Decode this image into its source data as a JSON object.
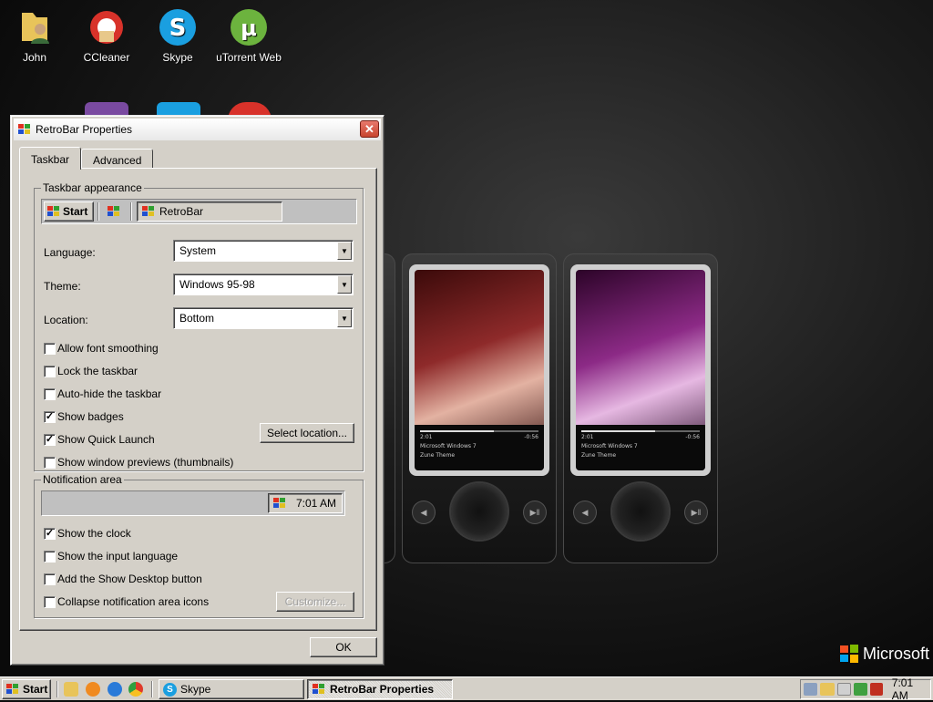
{
  "desktop": {
    "icons": [
      {
        "label": "John"
      },
      {
        "label": "CCleaner"
      },
      {
        "label": "Skype"
      },
      {
        "label": "uTorrent Web"
      }
    ],
    "branding": "Microsoft",
    "players": [
      {
        "title": "Microsoft Windows 7",
        "subtitle": "Zune Theme",
        "time_elapsed": "2:01",
        "time_remaining": "-0:56",
        "progress": 0.62
      },
      {
        "title": "Microsoft Windows 7",
        "subtitle": "Zune Theme",
        "time_elapsed": "2:01",
        "time_remaining": "-0:56",
        "progress": 0.62
      }
    ]
  },
  "dialog": {
    "title": "RetroBar Properties",
    "tabs": [
      {
        "label": "Taskbar",
        "active": true
      },
      {
        "label": "Advanced",
        "active": false
      }
    ],
    "taskbar_appearance": {
      "legend": "Taskbar appearance",
      "preview_start": "Start",
      "preview_window": "RetroBar"
    },
    "language": {
      "label": "Language:",
      "value": "System"
    },
    "theme": {
      "label": "Theme:",
      "value": "Windows 95-98"
    },
    "location": {
      "label": "Location:",
      "value": "Bottom"
    },
    "options": [
      {
        "label": "Allow font smoothing",
        "checked": false
      },
      {
        "label": "Lock the taskbar",
        "checked": false
      },
      {
        "label": "Auto-hide the taskbar",
        "checked": false
      },
      {
        "label": "Show badges",
        "checked": true
      },
      {
        "label": "Show Quick Launch",
        "checked": true
      },
      {
        "label": "Show window previews (thumbnails)",
        "checked": false
      }
    ],
    "select_location_button": "Select location...",
    "notification_area": {
      "legend": "Notification area",
      "preview_clock": "7:01 AM",
      "options": [
        {
          "label": "Show the clock",
          "checked": true
        },
        {
          "label": "Show the input language",
          "checked": false
        },
        {
          "label": "Add the Show Desktop button",
          "checked": false
        },
        {
          "label": "Collapse notification area icons",
          "checked": false
        }
      ],
      "customize_button": "Customize..."
    },
    "ok_button": "OK"
  },
  "taskbar": {
    "start_label": "Start",
    "windows": [
      {
        "label": "Skype",
        "active": false
      },
      {
        "label": "RetroBar Properties",
        "active": true
      }
    ],
    "clock": "7:01 AM"
  },
  "colors": {
    "dialog_face": "#d4d0c8",
    "close_button": "#c8442e",
    "checkmark": "#000000"
  }
}
